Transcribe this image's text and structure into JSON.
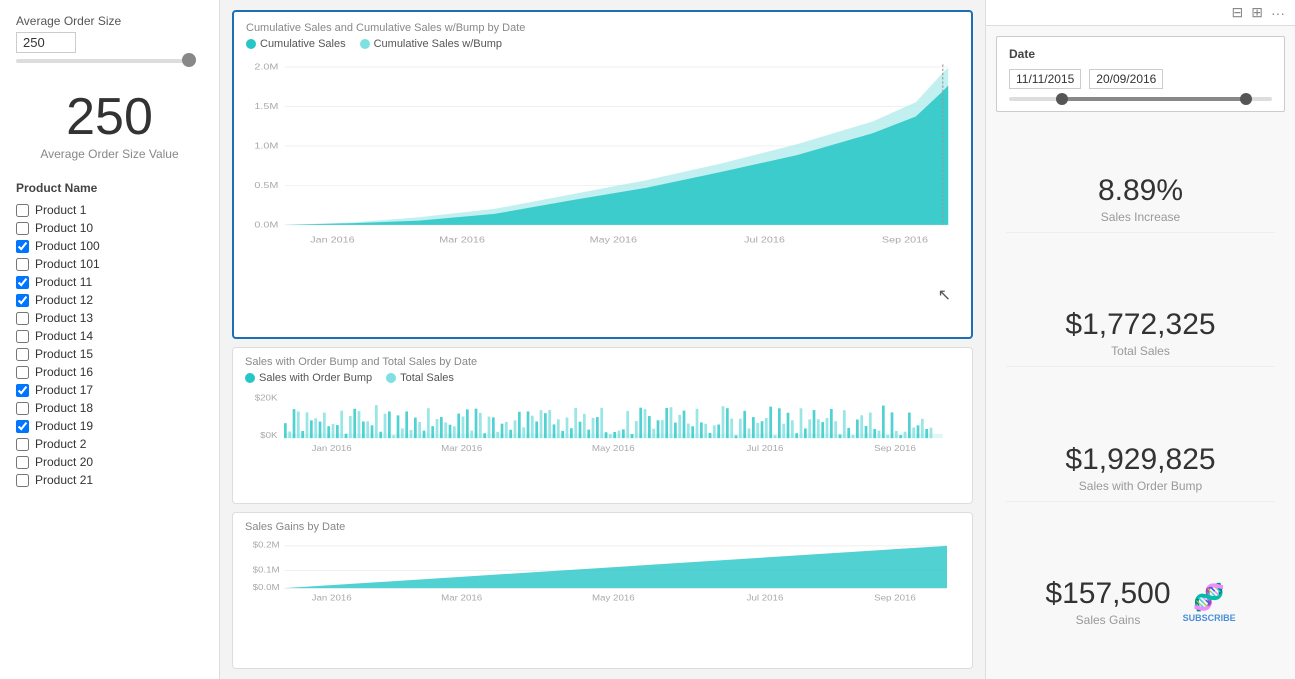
{
  "left": {
    "slider_label": "Average Order Size",
    "slider_value": "250",
    "big_number": "250",
    "big_label": "Average Order Size Value",
    "filter_title": "Product Name",
    "products": [
      {
        "name": "Product 1",
        "checked": false
      },
      {
        "name": "Product 10",
        "checked": false
      },
      {
        "name": "Product 100",
        "checked": true
      },
      {
        "name": "Product 101",
        "checked": false
      },
      {
        "name": "Product 11",
        "checked": true
      },
      {
        "name": "Product 12",
        "checked": true
      },
      {
        "name": "Product 13",
        "checked": false
      },
      {
        "name": "Product 14",
        "checked": false
      },
      {
        "name": "Product 15",
        "checked": false
      },
      {
        "name": "Product 16",
        "checked": false
      },
      {
        "name": "Product 17",
        "checked": true
      },
      {
        "name": "Product 18",
        "checked": false
      },
      {
        "name": "Product 19",
        "checked": true
      },
      {
        "name": "Product 2",
        "checked": false
      },
      {
        "name": "Product 20",
        "checked": false
      },
      {
        "name": "Product 21",
        "checked": false
      }
    ]
  },
  "main": {
    "chart1": {
      "title": "Cumulative Sales and Cumulative Sales w/Bump by Date",
      "legend": [
        {
          "label": "Cumulative Sales",
          "color": "#26c6c6"
        },
        {
          "label": "Cumulative Sales w/Bump",
          "color": "#7ee0e0"
        }
      ],
      "y_labels": [
        "2.0M",
        "1.5M",
        "1.0M",
        "0.5M",
        "0.0M"
      ],
      "x_labels": [
        "Jan 2016",
        "Mar 2016",
        "May 2016",
        "Jul 2016",
        "Sep 2016"
      ]
    },
    "chart2": {
      "title": "Sales with Order Bump and Total Sales by Date",
      "legend": [
        {
          "label": "Sales with Order Bump",
          "color": "#26c6c6"
        },
        {
          "label": "Total Sales",
          "color": "#7ee0e0"
        }
      ],
      "y_labels": [
        "$20K",
        "$0K"
      ],
      "x_labels": [
        "Jan 2016",
        "Mar 2016",
        "May 2016",
        "Jul 2016",
        "Sep 2016"
      ]
    },
    "chart3": {
      "title": "Sales Gains by Date",
      "y_labels": [
        "$0.2M",
        "$0.1M",
        "$0.0M"
      ],
      "x_labels": [
        "Jan 2016",
        "Mar 2016",
        "May 2016",
        "Jul 2016",
        "Sep 2016"
      ]
    }
  },
  "right": {
    "toolbar_icons": [
      "grid-icon",
      "expand-icon",
      "more-icon"
    ],
    "date_filter": {
      "title": "Date",
      "start": "11/11/2015",
      "end": "20/09/2016"
    },
    "kpis": [
      {
        "value": "8.89%",
        "label": "Sales Increase"
      },
      {
        "value": "$1,772,325",
        "label": "Total Sales"
      },
      {
        "value": "$1,929,825",
        "label": "Sales with Order Bump"
      },
      {
        "value": "$157,500",
        "label": "Sales Gains"
      }
    ]
  }
}
